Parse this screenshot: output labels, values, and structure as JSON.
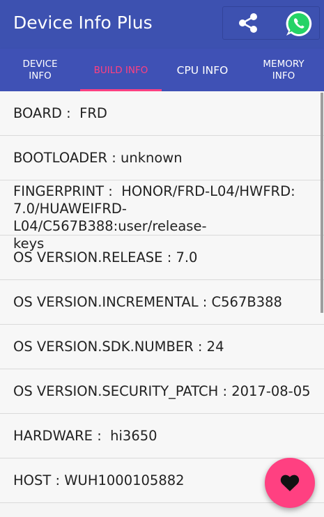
{
  "app": {
    "title": "Device Info Plus",
    "actions": [
      {
        "name": "share",
        "icon": "share-icon"
      },
      {
        "name": "whatsapp",
        "icon": "whatsapp-icon"
      }
    ]
  },
  "tabs": [
    {
      "label": "DEVICE\nINFO",
      "active": false
    },
    {
      "label": "BUILD INFO",
      "active": true
    },
    {
      "label": "CPU INFO",
      "active": false
    },
    {
      "label": "MEMORY\nINFO",
      "active": false
    }
  ],
  "rows": [
    "BOARD :  FRD",
    "BOOTLOADER : unknown",
    "FINGERPRINT :  HONOR/FRD-L04/HWFRD:\n7.0/HUAWEIFRD-L04/C567B388:user/release-\nkeys",
    "OS VERSION.RELEASE : 7.0",
    "OS VERSION.INCREMENTAL : C567B388",
    "OS VERSION.SDK.NUMBER : 24",
    "OS VERSION.SECURITY_PATCH : 2017-08-05",
    "HARDWARE :  hi3650",
    "HOST : WUH1000105882"
  ],
  "fab": {
    "icon": "heart-icon"
  },
  "colors": {
    "appbar": "#3d51b0",
    "tabbar": "#3f51b5",
    "accent": "#ff4081",
    "whatsapp_green": "#25d366"
  }
}
